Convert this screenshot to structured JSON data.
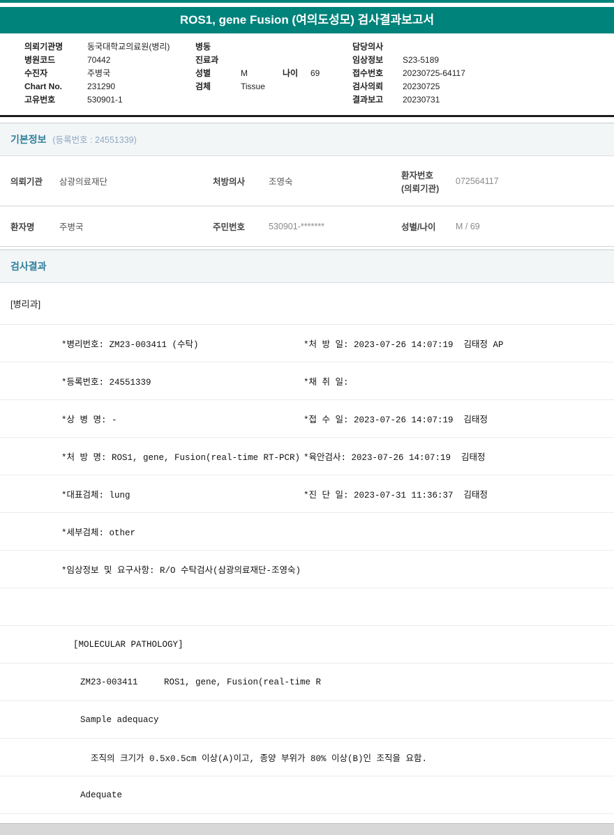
{
  "colors": {
    "accent_teal": "#00837b",
    "section_title_blue": "#2f7f9b",
    "header_rule_dark": "#1c1c1c"
  },
  "title": "ROS1, gene Fusion (여의도성모) 검사결과보고서",
  "patient_header": {
    "left": [
      {
        "label": "의뢰기관명",
        "value": "동국대학교의료원(병리)"
      },
      {
        "label": "병원코드",
        "value": "70442"
      },
      {
        "label": "수진자",
        "value": "주병국"
      },
      {
        "label": "Chart No.",
        "value": "231290"
      },
      {
        "label": "고유번호",
        "value": "530901-1"
      }
    ],
    "middle": [
      {
        "label": "병동",
        "value": ""
      },
      {
        "label": "진료과",
        "value": ""
      },
      {
        "label": "성별",
        "value": "M"
      },
      {
        "label": "검체",
        "value": "Tissue"
      }
    ],
    "age_label": "나이",
    "age_value": "69",
    "right": [
      {
        "label": "담당의사",
        "value": ""
      },
      {
        "label": "임상정보",
        "value": "S23-5189"
      },
      {
        "label": "접수번호",
        "value": "20230725-64117"
      },
      {
        "label": "검사의뢰",
        "value": "20230725"
      },
      {
        "label": "결과보고",
        "value": "20230731"
      }
    ]
  },
  "basic_info": {
    "title": "기본정보",
    "subtitle": "(등록번호 : 24551339)",
    "row1": {
      "c1_label": "의뢰기관",
      "c1_value": "삼광의료재단",
      "c2_label": "처방의사",
      "c2_value": "조영숙",
      "c3_label_line1": "환자번호",
      "c3_label_line2": "(의뢰기관)",
      "c3_value": "072564117"
    },
    "row2": {
      "c1_label": "환자명",
      "c1_value": "주병국",
      "c2_label": "주민번호",
      "c2_value": "530901-*******",
      "c3_label": "성별/나이",
      "c3_value": "M / 69"
    }
  },
  "results": {
    "title": "검사결과",
    "department": "[병리과]",
    "rows": [
      {
        "left": "*병리번호: ZM23-003411 (수탁)",
        "right": "*처 방 일: 2023-07-26 14:07:19  김태정 AP"
      },
      {
        "left": "*등록번호: 24551339",
        "right": "*채 취 일:"
      },
      {
        "left": "*상 병 명: -",
        "right": "*접 수 일: 2023-07-26 14:07:19  김태정"
      },
      {
        "left": "*처 방 명: ROS1, gene, Fusion(real-time RT-PCR)",
        "right": "*육안검사: 2023-07-26 14:07:19  김태정"
      },
      {
        "left": "*대표검체: lung",
        "right": "*진 단 일: 2023-07-31 11:36:37  김태정"
      },
      {
        "left": "*세부검체: other",
        "right": ""
      },
      {
        "left": "*임상정보 및 요구사항: R/O 수탁검사(삼광의료재단-조영숙)",
        "right": ""
      },
      {
        "left": "",
        "right": ""
      },
      {
        "left": "[MOLECULAR PATHOLOGY]",
        "right": ""
      },
      {
        "left": "ZM23-003411     ROS1, gene, Fusion(real-time R",
        "right": ""
      },
      {
        "left": "Sample adequacy",
        "right": ""
      },
      {
        "left": "조직의 크기가 0.5x0.5cm 이상(A)이고, 종양 부위가 80% 이상(B)인 조직을 요함.",
        "right": ""
      },
      {
        "left": "Adequate",
        "right": ""
      }
    ]
  }
}
